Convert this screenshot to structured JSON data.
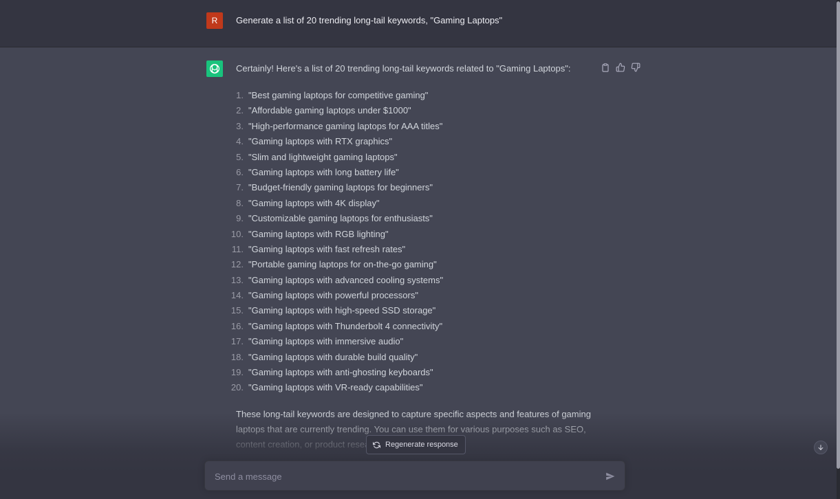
{
  "user_message": {
    "avatar_initial": "R",
    "text": "Generate a list of 20 trending long-tail keywords, \"Gaming Laptops\""
  },
  "assistant_message": {
    "intro": "Certainly! Here's a list of 20 trending long-tail keywords related to \"Gaming Laptops\":",
    "items": [
      {
        "num": "1.",
        "text": "\"Best gaming laptops for competitive gaming\""
      },
      {
        "num": "2.",
        "text": "\"Affordable gaming laptops under $1000\""
      },
      {
        "num": "3.",
        "text": "\"High-performance gaming laptops for AAA titles\""
      },
      {
        "num": "4.",
        "text": "\"Gaming laptops with RTX graphics\""
      },
      {
        "num": "5.",
        "text": "\"Slim and lightweight gaming laptops\""
      },
      {
        "num": "6.",
        "text": "\"Gaming laptops with long battery life\""
      },
      {
        "num": "7.",
        "text": "\"Budget-friendly gaming laptops for beginners\""
      },
      {
        "num": "8.",
        "text": "\"Gaming laptops with 4K display\""
      },
      {
        "num": "9.",
        "text": "\"Customizable gaming laptops for enthusiasts\""
      },
      {
        "num": "10.",
        "text": "\"Gaming laptops with RGB lighting\""
      },
      {
        "num": "11.",
        "text": "\"Gaming laptops with fast refresh rates\""
      },
      {
        "num": "12.",
        "text": "\"Portable gaming laptops for on-the-go gaming\""
      },
      {
        "num": "13.",
        "text": "\"Gaming laptops with advanced cooling systems\""
      },
      {
        "num": "14.",
        "text": "\"Gaming laptops with powerful processors\""
      },
      {
        "num": "15.",
        "text": "\"Gaming laptops with high-speed SSD storage\""
      },
      {
        "num": "16.",
        "text": "\"Gaming laptops with Thunderbolt 4 connectivity\""
      },
      {
        "num": "17.",
        "text": "\"Gaming laptops with immersive audio\""
      },
      {
        "num": "18.",
        "text": "\"Gaming laptops with durable build quality\""
      },
      {
        "num": "19.",
        "text": "\"Gaming laptops with anti-ghosting keyboards\""
      },
      {
        "num": "20.",
        "text": "\"Gaming laptops with VR-ready capabilities\""
      }
    ],
    "closing": "These long-tail keywords are designed to capture specific aspects and features of gaming laptops that are currently trending. You can use them for various purposes such as SEO, content creation, or product resea"
  },
  "regenerate_label": "Regenerate response",
  "composer": {
    "placeholder": "Send a message"
  },
  "icons": {
    "copy": "clipboard-icon",
    "like": "thumbs-up-icon",
    "dislike": "thumbs-down-icon",
    "regenerate": "refresh-icon",
    "scroll_down": "arrow-down-icon",
    "send": "send-icon",
    "assistant": "openai-logo-icon"
  },
  "colors": {
    "background_user": "#343541",
    "background_assistant": "#444654",
    "user_avatar": "#c0391b",
    "assistant_avatar": "#19c37d",
    "text": "#d1d5db"
  }
}
